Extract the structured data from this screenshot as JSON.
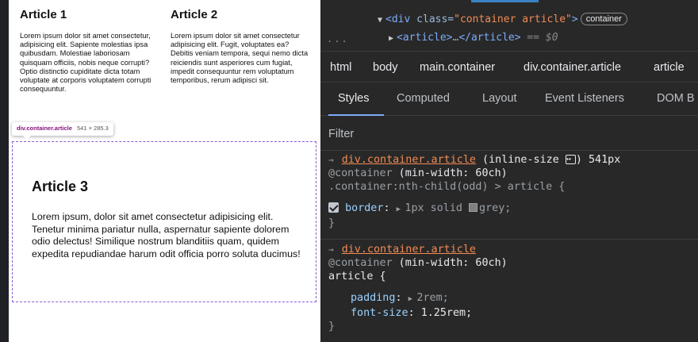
{
  "page": {
    "article1": {
      "title": "Article 1",
      "body": "Lorem ipsum dolor sit amet consectetur, adipisicing elit. Sapiente molestias ipsa quibusdam. Molestiae laboriosam quisquam officiis, nobis neque corrupti? Optio distinctio cupiditate dicta totam voluptate at corporis voluptatem corrupti consequuntur."
    },
    "article2": {
      "title": "Article 2",
      "body": "Lorem ipsum dolor sit amet consectetur adipisicing elit. Fugit, voluptates ea? Debitis veniam tempora, sequi nemo dicta reiciendis sunt asperiores cum fugiat, impedit consequuntur rem voluptatum temporibus, rerum adipisci sit."
    },
    "tooltip": {
      "name": "div.container.article",
      "size": "541 × 285.3"
    },
    "article3": {
      "title": "Article 3",
      "body": "Lorem ipsum, dolor sit amet consectetur adipisicing elit. Tenetur minima pariatur nulla, aspernatur sapiente dolorem odio delectus! Similique nostrum blanditiis quam, quidem expedita repudiandae harum odit officia porro soluta ducimus!"
    }
  },
  "devtools": {
    "dom": {
      "line1_tag_open": "<div",
      "line1_attr": " class=",
      "line1_value": "\"container article\"",
      "line1_tag_close": ">",
      "line1_badge": "container",
      "line2_tag": "<article>",
      "line2_ellipsis": "…",
      "line2_close": "</article>",
      "line2_eq": " == $0",
      "dots": "..."
    },
    "breadcrumbs": [
      "html",
      "body",
      "main.container",
      "div.container.article",
      "article"
    ],
    "tabs": [
      "Styles",
      "Computed",
      "Layout",
      "Event Listeners",
      "DOM B"
    ],
    "filter_placeholder": "Filter",
    "rule1": {
      "arrow": "→",
      "container_link": "div.container.article",
      "container_query": " (inline-size ",
      "container_query_end": ") 541px",
      "at_rule": "@container",
      "at_condition": " (min-width: 60ch)",
      "selector": ".container:nth-child(odd) > article {",
      "prop": "border",
      "colon": ": ",
      "value_pre": "1px solid ",
      "value_color": "grey",
      "semicolon": ";",
      "close": "}",
      "swatch_color": "#808080"
    },
    "rule2": {
      "arrow": "→",
      "container_link": "div.container.article",
      "at_rule": "@container",
      "at_condition": " (min-width: 60ch)",
      "selector": "article {",
      "prop1": "padding",
      "value1": "2rem;",
      "prop2": "font-size",
      "value2": "1.25rem;",
      "close": "}"
    }
  },
  "colors": {
    "devtools_bg": "#282828",
    "highlight_border": "#8a5cd6",
    "link_orange": "#f28b54",
    "tag_blue": "#7cacf8",
    "prop_blue": "#9ad2ff"
  }
}
